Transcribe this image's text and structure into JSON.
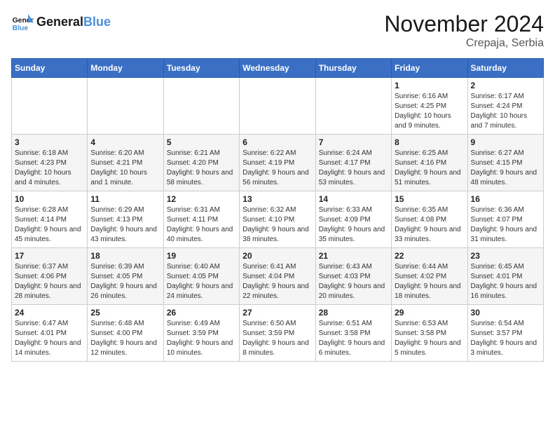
{
  "header": {
    "logo_line1": "General",
    "logo_line2": "Blue",
    "month": "November 2024",
    "location": "Crepaja, Serbia"
  },
  "weekdays": [
    "Sunday",
    "Monday",
    "Tuesday",
    "Wednesday",
    "Thursday",
    "Friday",
    "Saturday"
  ],
  "weeks": [
    [
      {
        "day": "",
        "info": ""
      },
      {
        "day": "",
        "info": ""
      },
      {
        "day": "",
        "info": ""
      },
      {
        "day": "",
        "info": ""
      },
      {
        "day": "",
        "info": ""
      },
      {
        "day": "1",
        "info": "Sunrise: 6:16 AM\nSunset: 4:25 PM\nDaylight: 10 hours and 9 minutes."
      },
      {
        "day": "2",
        "info": "Sunrise: 6:17 AM\nSunset: 4:24 PM\nDaylight: 10 hours and 7 minutes."
      }
    ],
    [
      {
        "day": "3",
        "info": "Sunrise: 6:18 AM\nSunset: 4:23 PM\nDaylight: 10 hours and 4 minutes."
      },
      {
        "day": "4",
        "info": "Sunrise: 6:20 AM\nSunset: 4:21 PM\nDaylight: 10 hours and 1 minute."
      },
      {
        "day": "5",
        "info": "Sunrise: 6:21 AM\nSunset: 4:20 PM\nDaylight: 9 hours and 58 minutes."
      },
      {
        "day": "6",
        "info": "Sunrise: 6:22 AM\nSunset: 4:19 PM\nDaylight: 9 hours and 56 minutes."
      },
      {
        "day": "7",
        "info": "Sunrise: 6:24 AM\nSunset: 4:17 PM\nDaylight: 9 hours and 53 minutes."
      },
      {
        "day": "8",
        "info": "Sunrise: 6:25 AM\nSunset: 4:16 PM\nDaylight: 9 hours and 51 minutes."
      },
      {
        "day": "9",
        "info": "Sunrise: 6:27 AM\nSunset: 4:15 PM\nDaylight: 9 hours and 48 minutes."
      }
    ],
    [
      {
        "day": "10",
        "info": "Sunrise: 6:28 AM\nSunset: 4:14 PM\nDaylight: 9 hours and 45 minutes."
      },
      {
        "day": "11",
        "info": "Sunrise: 6:29 AM\nSunset: 4:13 PM\nDaylight: 9 hours and 43 minutes."
      },
      {
        "day": "12",
        "info": "Sunrise: 6:31 AM\nSunset: 4:11 PM\nDaylight: 9 hours and 40 minutes."
      },
      {
        "day": "13",
        "info": "Sunrise: 6:32 AM\nSunset: 4:10 PM\nDaylight: 9 hours and 38 minutes."
      },
      {
        "day": "14",
        "info": "Sunrise: 6:33 AM\nSunset: 4:09 PM\nDaylight: 9 hours and 35 minutes."
      },
      {
        "day": "15",
        "info": "Sunrise: 6:35 AM\nSunset: 4:08 PM\nDaylight: 9 hours and 33 minutes."
      },
      {
        "day": "16",
        "info": "Sunrise: 6:36 AM\nSunset: 4:07 PM\nDaylight: 9 hours and 31 minutes."
      }
    ],
    [
      {
        "day": "17",
        "info": "Sunrise: 6:37 AM\nSunset: 4:06 PM\nDaylight: 9 hours and 28 minutes."
      },
      {
        "day": "18",
        "info": "Sunrise: 6:39 AM\nSunset: 4:05 PM\nDaylight: 9 hours and 26 minutes."
      },
      {
        "day": "19",
        "info": "Sunrise: 6:40 AM\nSunset: 4:05 PM\nDaylight: 9 hours and 24 minutes."
      },
      {
        "day": "20",
        "info": "Sunrise: 6:41 AM\nSunset: 4:04 PM\nDaylight: 9 hours and 22 minutes."
      },
      {
        "day": "21",
        "info": "Sunrise: 6:43 AM\nSunset: 4:03 PM\nDaylight: 9 hours and 20 minutes."
      },
      {
        "day": "22",
        "info": "Sunrise: 6:44 AM\nSunset: 4:02 PM\nDaylight: 9 hours and 18 minutes."
      },
      {
        "day": "23",
        "info": "Sunrise: 6:45 AM\nSunset: 4:01 PM\nDaylight: 9 hours and 16 minutes."
      }
    ],
    [
      {
        "day": "24",
        "info": "Sunrise: 6:47 AM\nSunset: 4:01 PM\nDaylight: 9 hours and 14 minutes."
      },
      {
        "day": "25",
        "info": "Sunrise: 6:48 AM\nSunset: 4:00 PM\nDaylight: 9 hours and 12 minutes."
      },
      {
        "day": "26",
        "info": "Sunrise: 6:49 AM\nSunset: 3:59 PM\nDaylight: 9 hours and 10 minutes."
      },
      {
        "day": "27",
        "info": "Sunrise: 6:50 AM\nSunset: 3:59 PM\nDaylight: 9 hours and 8 minutes."
      },
      {
        "day": "28",
        "info": "Sunrise: 6:51 AM\nSunset: 3:58 PM\nDaylight: 9 hours and 6 minutes."
      },
      {
        "day": "29",
        "info": "Sunrise: 6:53 AM\nSunset: 3:58 PM\nDaylight: 9 hours and 5 minutes."
      },
      {
        "day": "30",
        "info": "Sunrise: 6:54 AM\nSunset: 3:57 PM\nDaylight: 9 hours and 3 minutes."
      }
    ]
  ]
}
